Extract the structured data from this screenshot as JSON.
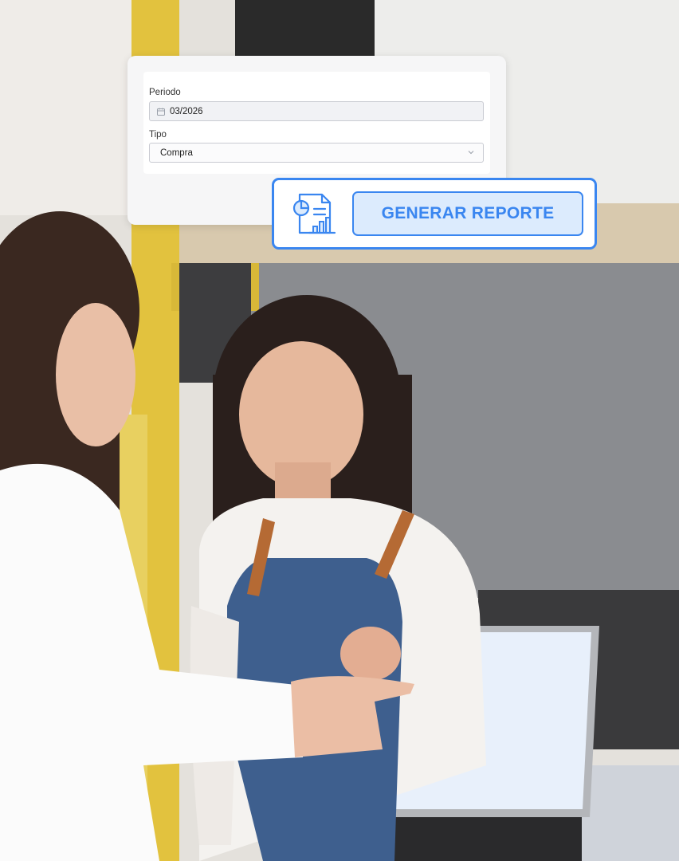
{
  "form": {
    "periodo_label": "Periodo",
    "periodo_value": "03/2026",
    "tipo_label": "Tipo",
    "tipo_value": "Compra"
  },
  "report": {
    "button_label": "GENERAR REPORTE"
  },
  "colors": {
    "accent": "#3a86f0",
    "button_fill": "#dcebfd"
  },
  "icons": {
    "calendar": "calendar-icon",
    "dropdown": "chevron-down-icon",
    "report": "report-chart-icon"
  },
  "scene": {
    "description_hint": "photo background"
  }
}
